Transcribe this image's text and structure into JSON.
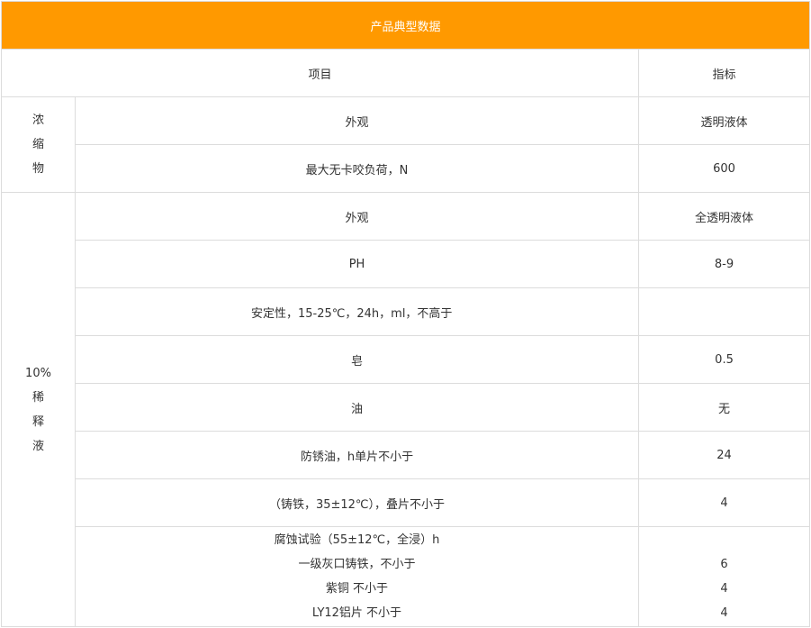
{
  "title": "产品典型数据",
  "header": {
    "item": "项目",
    "indicator": "指标"
  },
  "concentrate": {
    "label_chars": [
      "浓",
      "缩",
      "物"
    ],
    "rows": [
      {
        "item": "外观",
        "value": "透明液体"
      },
      {
        "item": "最大无卡咬负荷，N",
        "value": "600"
      }
    ]
  },
  "dilution": {
    "label_lines": [
      "10%",
      "稀",
      "释",
      "液"
    ],
    "rows": [
      {
        "item": "外观",
        "value": "全透明液体"
      },
      {
        "item": "PH",
        "value": "8-9"
      },
      {
        "item": "安定性，15-25℃，24h，ml，不高于",
        "value": ""
      },
      {
        "item": "皂",
        "value": "0.5"
      },
      {
        "item": "油",
        "value": "无"
      },
      {
        "item": "防锈油，h单片不小于",
        "value": "24"
      },
      {
        "item": "（铸铁，35±12℃），叠片不小于",
        "value": "4"
      }
    ],
    "corrosion": {
      "item_lines": [
        "腐蚀试验（55±12℃，全浸）h",
        "一级灰口铸铁，不小于",
        "紫铜  不小于",
        "LY12铝片  不小于"
      ],
      "value_lines": [
        "",
        "6",
        "4",
        "4"
      ]
    }
  }
}
